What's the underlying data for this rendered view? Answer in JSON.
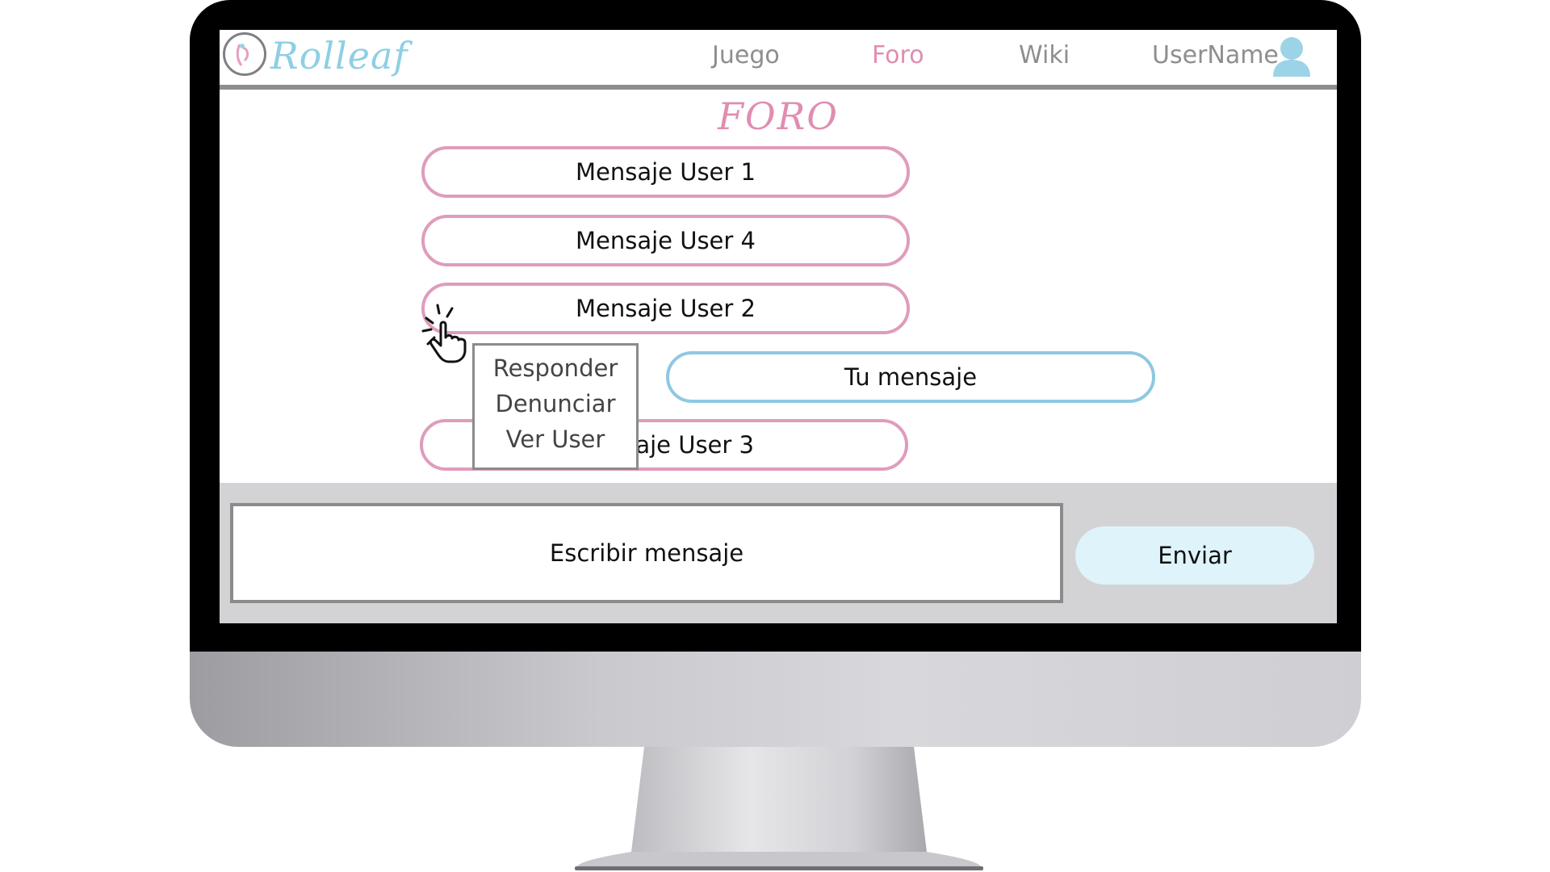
{
  "app": {
    "logo_text": "Rolleaf"
  },
  "nav": {
    "items": [
      {
        "label": "Juego"
      },
      {
        "label": "Foro"
      },
      {
        "label": "Wiki"
      }
    ],
    "username": "UserName"
  },
  "page": {
    "title": "FORO"
  },
  "messages": [
    {
      "label": "Mensaje User 1"
    },
    {
      "label": "Mensaje User 4"
    },
    {
      "label": "Mensaje User 2"
    },
    {
      "label": "Tu mensaje"
    },
    {
      "label": "Mensaje User 3"
    }
  ],
  "context_menu": {
    "items": [
      {
        "label": "Responder"
      },
      {
        "label": "Denunciar"
      },
      {
        "label": "Ver User"
      }
    ]
  },
  "compose": {
    "input_value": "Escribir mensaje",
    "send_label": "Enviar"
  },
  "colors": {
    "accent_pink": "#e08db2",
    "accent_blue": "#8ecfe4",
    "send_bg": "#dff3fb"
  }
}
